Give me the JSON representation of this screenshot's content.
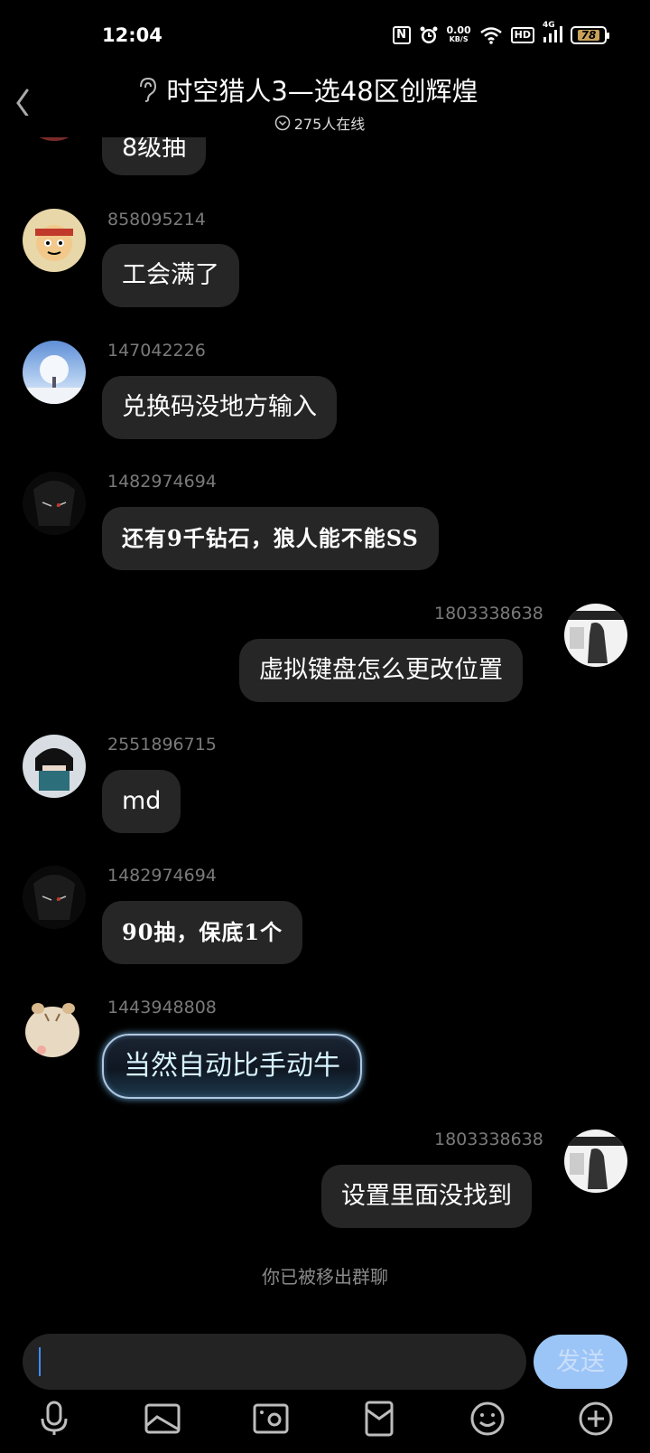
{
  "status_bar": {
    "time": "12:04",
    "net_speed_value": "0.00",
    "net_speed_unit": "KB/S",
    "nfc_label": "N",
    "hd_label": "HD",
    "network_label": "4G",
    "battery_level": "78"
  },
  "header": {
    "title": "时空猎人3—选48区创辉煌",
    "online_count": "275人在线"
  },
  "messages": [
    {
      "id": "m0",
      "sender": "",
      "text": "8级抽",
      "side": "left"
    },
    {
      "id": "m1",
      "sender": "858095214",
      "text": "工会满了",
      "side": "left"
    },
    {
      "id": "m2",
      "sender": "147042226",
      "text": "兑换码没地方输入",
      "side": "left"
    },
    {
      "id": "m3",
      "sender": "1482974694",
      "text": "还有9千钻石，狼人能不能SS",
      "side": "left"
    },
    {
      "id": "m4",
      "sender": "1803338638",
      "text": "虚拟键盘怎么更改位置",
      "side": "right"
    },
    {
      "id": "m5",
      "sender": "2551896715",
      "text": "md",
      "side": "left"
    },
    {
      "id": "m6",
      "sender": "1482974694",
      "text": "90抽，保底1个",
      "side": "left"
    },
    {
      "id": "m7",
      "sender": "1443948808",
      "text": "当然自动比手动牛",
      "side": "left"
    },
    {
      "id": "m8",
      "sender": "1803338638",
      "text": "设置里面没找到",
      "side": "right"
    }
  ],
  "system_note": "你已被移出群聊",
  "input": {
    "value": "",
    "send_label": "发送"
  },
  "toolbar": {
    "icons": [
      "microphone-icon",
      "image-icon",
      "camera-icon",
      "red-packet-icon",
      "emoji-icon",
      "plus-icon"
    ]
  },
  "colors": {
    "background": "#000000",
    "bubble": "#262626",
    "send_button": "#9cc5f7",
    "caret": "#3f8cff"
  }
}
